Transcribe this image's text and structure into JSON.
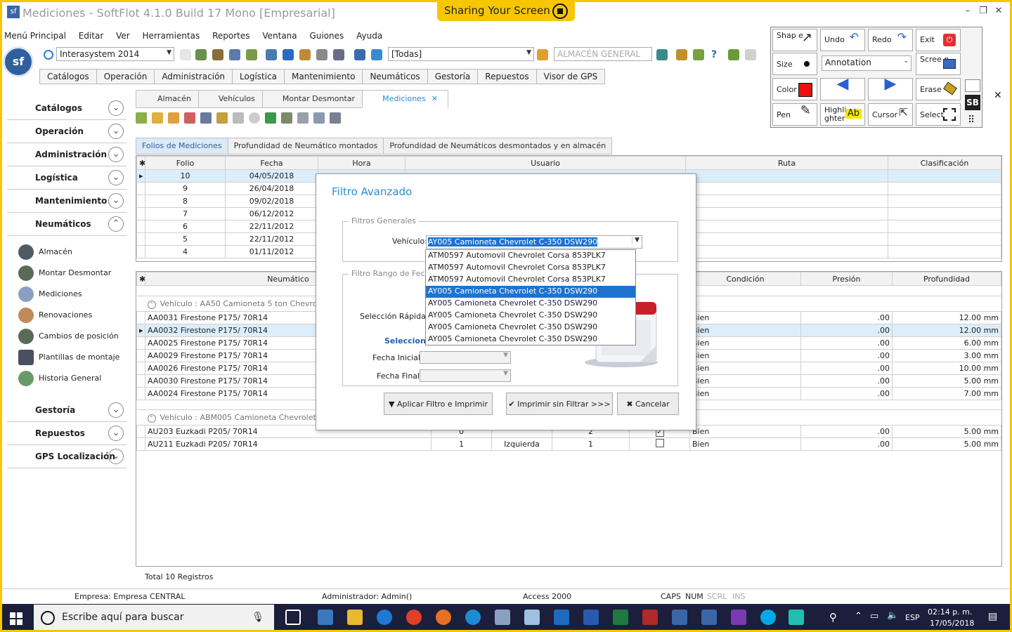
{
  "window": {
    "title": "Mediciones - SoftFlot 4.1.0 Build 17 Mono  [Empresarial]",
    "share_label": "Sharing Your Screen"
  },
  "menu": [
    "Menú Principal",
    "Editar",
    "Ver",
    "Herramientas",
    "Reportes",
    "Ventana",
    "Guiones",
    "Ayuda"
  ],
  "toolbar": {
    "company": "Interasystem 2014",
    "route_filter": "[Todas]",
    "warehouse_placeholder": "ALMACÉN GENERAL"
  },
  "module_tabs": [
    "Catálogos",
    "Operación",
    "Administración",
    "Logística",
    "Mantenimiento",
    "Neumáticos",
    "Gestoría",
    "Repuestos",
    "Visor de GPS"
  ],
  "nav": {
    "top_sections": [
      "Catálogos",
      "Operación",
      "Administración",
      "Logística",
      "Mantenimiento",
      "Neumáticos"
    ],
    "sub_items": [
      "Almacén",
      "Montar Desmontar",
      "Mediciones",
      "Renovaciones",
      "Cambios de posición",
      "Plantillas de montaje",
      "Historia General"
    ],
    "bottom_sections": [
      "Gestoría",
      "Repuestos",
      "GPS Localización"
    ]
  },
  "doc_tabs": [
    "Almacén",
    "Vehículos",
    "Montar Desmontar",
    "Mediciones"
  ],
  "inner_tabs": [
    "Folios de Mediciones",
    "Profundidad de Neumático montados",
    "Profundidad de Neumáticos desmontados y en almacén"
  ],
  "top_grid": {
    "headers": [
      "Folio",
      "Fecha",
      "Hora",
      "Usuario",
      "Ruta",
      "Clasificación"
    ],
    "rows": [
      [
        "10",
        "04/05/2018"
      ],
      [
        "9",
        "26/04/2018"
      ],
      [
        "8",
        "09/02/2018"
      ],
      [
        "7",
        "06/12/2012"
      ],
      [
        "6",
        "22/11/2012"
      ],
      [
        "5",
        "22/11/2012"
      ],
      [
        "4",
        "01/11/2012"
      ]
    ]
  },
  "bottom_grid": {
    "headers": [
      "Neumático",
      "Condición",
      "Presión",
      "Profundidad"
    ],
    "group1": "Vehículo : AA50 Camioneta 5 ton  Chevrolet",
    "rows1": [
      [
        "AA0031 Firestone  P175/ 70R14",
        "Bien",
        ".00",
        "12.00 mm"
      ],
      [
        "AA0032 Firestone  P175/ 70R14",
        "Bien",
        ".00",
        "12.00 mm"
      ],
      [
        "AA0025 Firestone  P175/ 70R14",
        "Bien",
        ".00",
        "6.00 mm"
      ],
      [
        "AA0029 Firestone  P175/ 70R14",
        "Bien",
        ".00",
        "3.00 mm"
      ],
      [
        "AA0026 Firestone  P175/ 70R14",
        "Bien",
        ".00",
        "10.00 mm"
      ],
      [
        "AA0030 Firestone  P175/ 70R14",
        "Bien",
        ".00",
        "5.00 mm"
      ],
      [
        "AA0024 Firestone  P175/ 70R14",
        "Bien",
        ".00",
        "7.00 mm"
      ]
    ],
    "group2": "Vehículo : ABM005 Camioneta  Chevrolet  DT-466  HHH555",
    "rows2": [
      [
        "AU203 Euzkadi  P205/ 70R14",
        "0",
        "",
        "2",
        "Bien",
        ".00",
        "5.00 mm"
      ],
      [
        "AU211 Euzkadi  P205/ 70R14",
        "1",
        "Izquierda",
        "1",
        "Bien",
        ".00",
        "5.00 mm"
      ]
    ]
  },
  "total": "Total 10 Registros",
  "status": {
    "empresa": "Empresa: Empresa CENTRAL",
    "admin": "Administrador: Admin()",
    "db": "Access 2000",
    "caps": "CAPS",
    "num": "NUM",
    "scrl": "SCRL",
    "ins": "INS"
  },
  "dialog": {
    "title": "Filtro Avanzado",
    "group1": "Filtros Generales",
    "vehicle_label": "Vehículo:",
    "vehicle_value": "AY005 Camioneta  Chevrolet  C-350  DSW290",
    "group2": "Filtro Rango de Fecha",
    "quick_label": "Selección Rápida:",
    "select_label": "Seleccion",
    "start_label": "Fecha Inicial:",
    "end_label": "Fecha Final:",
    "btn_apply": "Aplicar Filtro e Imprimir",
    "btn_print": "Imprimir sin Filtrar >>>",
    "btn_cancel": "Cancelar",
    "options": [
      "ATM0597 Automovil  Chevrolet  Corsa  853PLK7",
      "ATM0597 Automovil  Chevrolet  Corsa  853PLK7",
      "ATM0597 Automovil  Chevrolet  Corsa  853PLK7",
      "AY005 Camioneta  Chevrolet  C-350  DSW290",
      "AY005 Camioneta  Chevrolet  C-350  DSW290",
      "AY005 Camioneta  Chevrolet  C-350  DSW290",
      "AY005 Camioneta  Chevrolet  C-350  DSW290",
      "AY005 Camioneta  Chevrolet  C-350  DSW290"
    ]
  },
  "annot": {
    "shape": "Shap e",
    "undo": "Undo",
    "redo": "Redo",
    "exit": "Exit",
    "size": "Size",
    "mode": "Annotation",
    "screen": "Scree n",
    "color": "Color",
    "erase": "Erase",
    "pen": "Pen",
    "highlighter": "Highli ghter",
    "cursor": "Cursor",
    "select": "Select",
    "hl_sample": "Ab",
    "sb": "SB",
    "color_value": "#e81010"
  },
  "taskbar": {
    "search": "Escribe aquí para buscar",
    "lang": "ESP",
    "time": "02:14 p. m.",
    "date": "17/05/2018"
  }
}
